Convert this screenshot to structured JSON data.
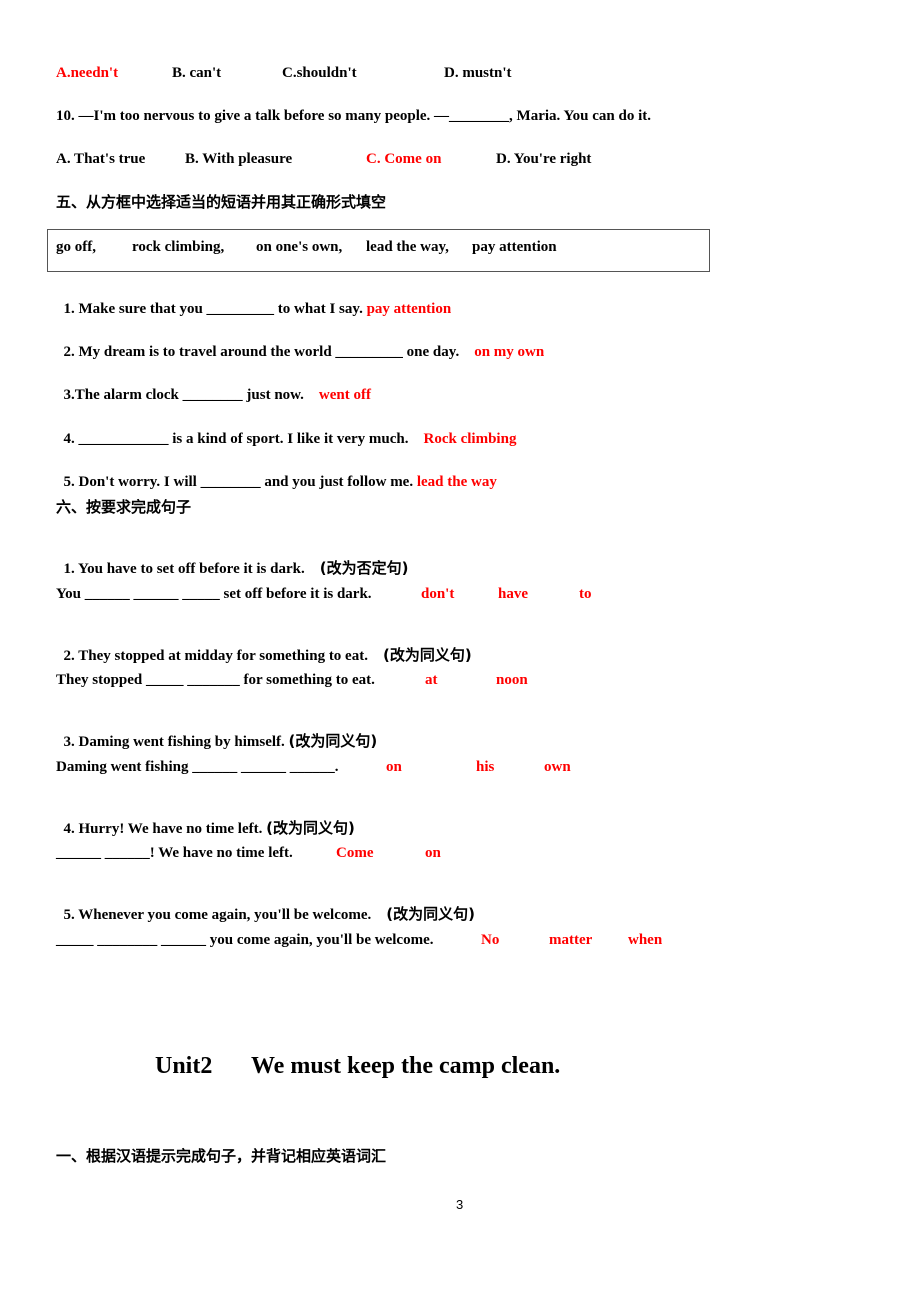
{
  "q9_options": [
    {
      "label": "A.needn't",
      "correct": true
    },
    {
      "label": "B. can't",
      "correct": false
    },
    {
      "label": "C.shouldn't",
      "correct": false
    },
    {
      "label": "D. mustn't",
      "correct": false
    }
  ],
  "q10": {
    "stem": "10. —I'm too nervous to give a talk before so many people. —________, Maria. You can do it.",
    "options": [
      {
        "label": "A. That's true",
        "correct": false
      },
      {
        "label": "B. With pleasure",
        "correct": false
      },
      {
        "label": "C. Come on",
        "correct": true
      },
      {
        "label": "D. You're right",
        "correct": false
      }
    ]
  },
  "section5": {
    "heading": "五、从方框中选择适当的短语并用其正确形式填空",
    "phrases": [
      "go off,",
      "rock climbing,",
      "on one's own,",
      "lead the way,",
      "pay attention"
    ],
    "items": [
      {
        "text": "1. Make sure that you _________ to what I say.",
        "answer": "pay attention"
      },
      {
        "text": "2. My dream is to travel around the world _________ one day.",
        "answer": "on my own"
      },
      {
        "text": "3.The alarm clock ________ just now.",
        "answer": "went off"
      },
      {
        "text": "4. ____________ is a kind of sport. I like it very much.",
        "answer": "Rock climbing"
      },
      {
        "text": "5. Don't worry. I will ________ and you just follow me.",
        "answer": "lead the way"
      }
    ]
  },
  "section6": {
    "heading": "六、按要求完成句子",
    "items": [
      {
        "question": "1. You have to set off before it is dark.",
        "instruction": "(改为否定句)",
        "blank": "You ______ ______ _____ set off before it is dark.",
        "answers": [
          "don't",
          "have",
          "to"
        ]
      },
      {
        "question": "2. They stopped at midday for something to eat.",
        "instruction": "(改为同义句)",
        "blank": "They stopped _____ _______ for something to eat.",
        "answers": [
          "at",
          "noon"
        ]
      },
      {
        "question": "3. Daming went fishing by himself.",
        "instruction": "(改为同义句)",
        "blank": "Daming went fishing ______ ______ ______.",
        "answers": [
          "on",
          "his",
          "own"
        ]
      },
      {
        "question": "4. Hurry! We have no time left.",
        "instruction": "(改为同义句)",
        "blank": "______ ______! We have no time left.",
        "answers": [
          "Come",
          "on"
        ]
      },
      {
        "question": "5. Whenever you come again, you'll be welcome.",
        "instruction": "(改为同义句)",
        "blank": "_____ ________ ______ you come again, you'll be welcome.",
        "answers": [
          "No",
          "matter",
          "when"
        ]
      }
    ]
  },
  "unit_title": {
    "unit": "Unit2",
    "title": "We must keep the camp clean."
  },
  "next_section_heading": "一、根据汉语提示完成句子，并背记相应英语词汇",
  "page_number": "3",
  "colors": {
    "answer": "#ff0000",
    "text": "#000000"
  }
}
